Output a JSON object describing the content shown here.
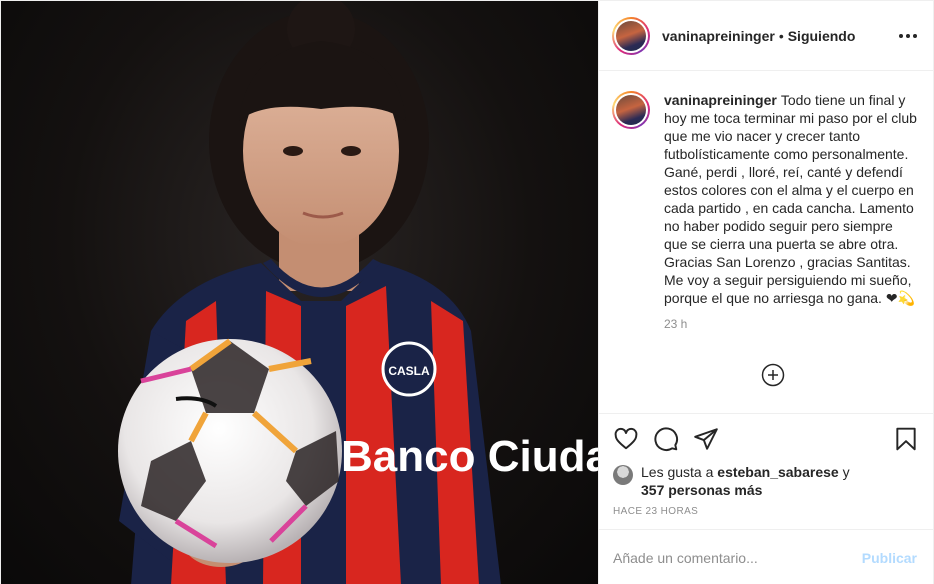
{
  "header": {
    "username": "vaninapreininger",
    "separator": "•",
    "follow_status": "Siguiendo",
    "more_icon": "more-options-icon"
  },
  "caption": {
    "username": "vaninapreininger",
    "text": "Todo tiene un final y hoy me toca terminar mi paso por el club que me vio nacer y crecer tanto futbolísticamente como personalmente. Gané, perdi , lloré, reí, canté y defendí estos colores con el alma y el cuerpo en cada partido , en cada cancha. Lamento no haber podido seguir pero siempre que se cierra una puerta se abre otra. Gracias San Lorenzo , gracias Santitas. Me voy a seguir persiguiendo mi sueño, porque el que no arriesga no gana. ❤💫",
    "time": "23 h"
  },
  "photo": {
    "jersey_text": "Banco Ciuda",
    "crest_text": "CASLA"
  },
  "actions": {
    "like_icon": "heart-icon",
    "comment_icon": "comment-icon",
    "share_icon": "share-icon",
    "save_icon": "bookmark-icon",
    "load_more_icon": "plus-circle-icon"
  },
  "likes": {
    "prefix": "Les gusta a ",
    "user": "esteban_sabarese",
    "connector": " y",
    "others": "357 personas más"
  },
  "posted_ago": "HACE 23 HORAS",
  "comment_box": {
    "placeholder": "Añade un comentario...",
    "post_label": "Publicar",
    "post_color": "#b3dbff"
  }
}
